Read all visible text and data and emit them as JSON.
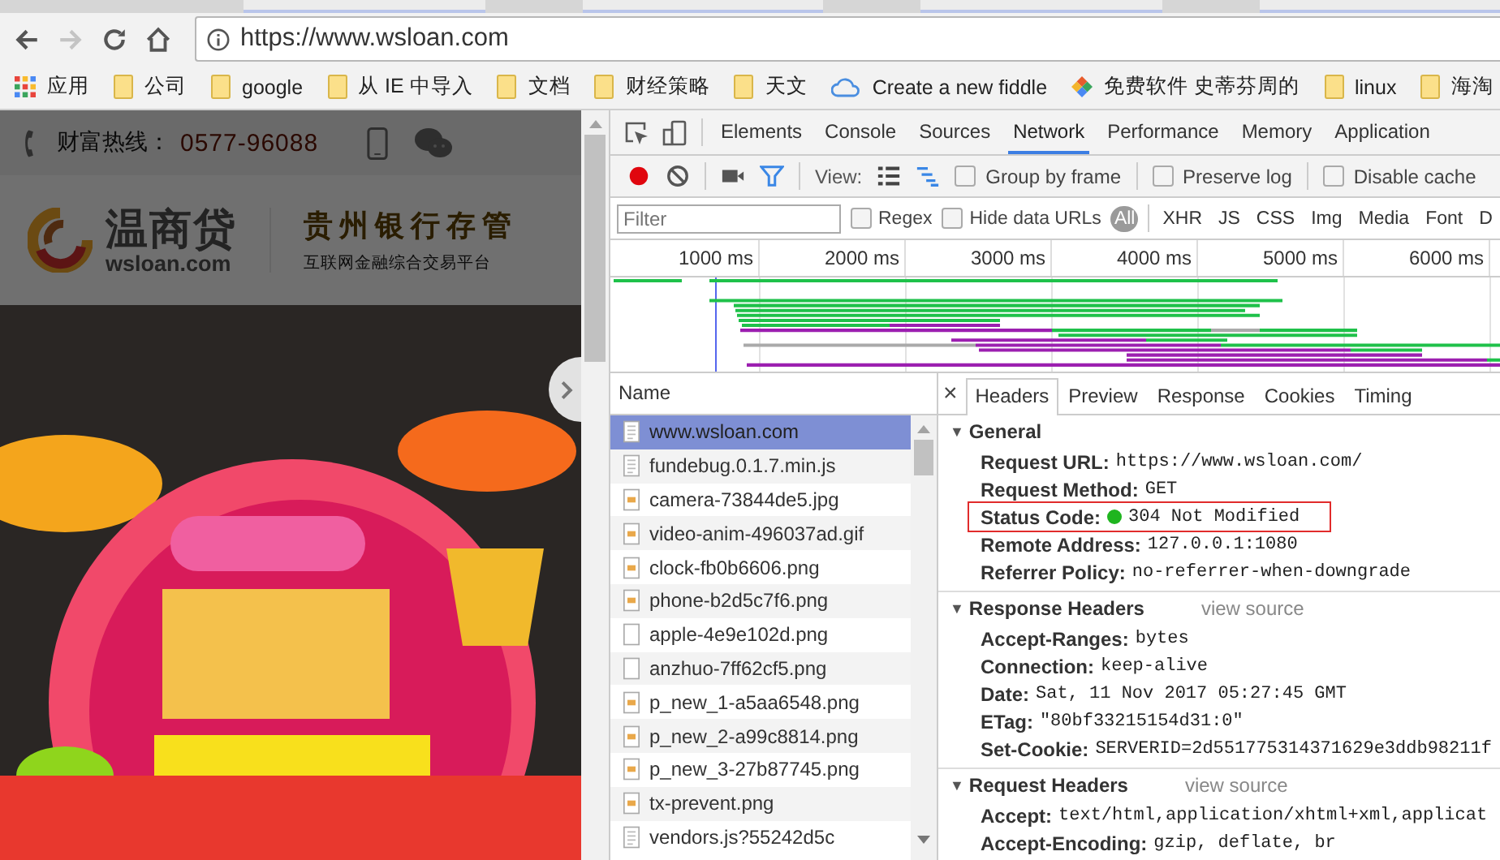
{
  "browser": {
    "url": "https://www.wsloan.com",
    "forward_disabled": true,
    "bookmarks": [
      {
        "label": "应用",
        "kind": "apps"
      },
      {
        "label": "公司",
        "kind": "folder"
      },
      {
        "label": "google",
        "kind": "folder"
      },
      {
        "label": "从 IE 中导入",
        "kind": "folder"
      },
      {
        "label": "文档",
        "kind": "folder"
      },
      {
        "label": "财经策略",
        "kind": "folder"
      },
      {
        "label": "天文",
        "kind": "folder"
      },
      {
        "label": "Create a new fiddle",
        "kind": "cloud"
      },
      {
        "label": "免费软件 史蒂芬周的",
        "kind": "site"
      },
      {
        "label": "linux",
        "kind": "folder"
      },
      {
        "label": "海淘",
        "kind": "folder"
      }
    ]
  },
  "page": {
    "hotline_label": "财富热线：",
    "hotline_number": "0577-96088",
    "logo_name": "温商贷",
    "logo_domain": "wsloan.com",
    "bank_text": "贵州银行存管",
    "slogan": "互联网金融综合交易平台"
  },
  "devtools": {
    "tabs": [
      {
        "label": "Elements",
        "selected": false
      },
      {
        "label": "Console",
        "selected": false
      },
      {
        "label": "Sources",
        "selected": false
      },
      {
        "label": "Network",
        "selected": true
      },
      {
        "label": "Performance",
        "selected": false
      },
      {
        "label": "Memory",
        "selected": false
      },
      {
        "label": "Application",
        "selected": false
      }
    ],
    "recording": true,
    "view_label": "View:",
    "toolbar_options": [
      {
        "label": "Group by frame",
        "checked": false
      },
      {
        "label": "Preserve log",
        "checked": false
      },
      {
        "label": "Disable cache",
        "checked": false
      }
    ],
    "filter": {
      "placeholder": "Filter"
    },
    "filter_options": [
      {
        "label": "Regex",
        "checked": false
      },
      {
        "label": "Hide data URLs",
        "checked": false
      }
    ],
    "types": [
      {
        "label": "All",
        "selected": true
      },
      {
        "label": "XHR",
        "selected": false
      },
      {
        "label": "JS",
        "selected": false
      },
      {
        "label": "CSS",
        "selected": false
      },
      {
        "label": "Img",
        "selected": false
      },
      {
        "label": "Media",
        "selected": false
      },
      {
        "label": "Font",
        "selected": false
      },
      {
        "label": "D",
        "selected": false
      }
    ],
    "ruler": [
      "1000 ms",
      "2000 ms",
      "3000 ms",
      "4000 ms",
      "5000 ms",
      "6000 ms"
    ],
    "requests": {
      "column": "Name",
      "rows": [
        {
          "name": "www.wsloan.com",
          "kind": "document",
          "selected": true
        },
        {
          "name": "fundebug.0.1.7.min.js",
          "kind": "document",
          "selected": false
        },
        {
          "name": "camera-73844de5.jpg",
          "kind": "image",
          "selected": false
        },
        {
          "name": "video-anim-496037ad.gif",
          "kind": "image",
          "selected": false
        },
        {
          "name": "clock-fb0b6606.png",
          "kind": "image",
          "selected": false
        },
        {
          "name": "phone-b2d5c7f6.png",
          "kind": "image",
          "selected": false
        },
        {
          "name": "apple-4e9e102d.png",
          "kind": "blank",
          "selected": false
        },
        {
          "name": "anzhuo-7ff62cf5.png",
          "kind": "blank",
          "selected": false
        },
        {
          "name": "p_new_1-a5aa6548.png",
          "kind": "image",
          "selected": false
        },
        {
          "name": "p_new_2-a99c8814.png",
          "kind": "image",
          "selected": false
        },
        {
          "name": "p_new_3-27b87745.png",
          "kind": "image",
          "selected": false
        },
        {
          "name": "tx-prevent.png",
          "kind": "image",
          "selected": false
        },
        {
          "name": "vendors.js?55242d5c",
          "kind": "document",
          "selected": false
        }
      ]
    },
    "close_icon": "×",
    "detail_tabs": [
      {
        "label": "Headers",
        "selected": true
      },
      {
        "label": "Preview",
        "selected": false
      },
      {
        "label": "Response",
        "selected": false
      },
      {
        "label": "Cookies",
        "selected": false
      },
      {
        "label": "Timing",
        "selected": false
      }
    ],
    "sections": [
      {
        "title": "General",
        "arrow": "▼",
        "expanded": true,
        "rows": [
          {
            "key": "Request URL:",
            "value": "https://www.wsloan.com/"
          },
          {
            "key": "Request Method:",
            "value": "GET"
          },
          {
            "key": "Status Code:",
            "value": "304 Not Modified",
            "color": "#1fb51f",
            "highlighted": true
          },
          {
            "key": "Remote Address:",
            "value": "127.0.0.1:1080"
          },
          {
            "key": "Referrer Policy:",
            "value": "no-referrer-when-downgrade"
          }
        ]
      },
      {
        "title": "Response Headers",
        "arrow": "▼",
        "expanded": true,
        "link": "view source",
        "rows": [
          {
            "key": "Accept-Ranges:",
            "value": "bytes"
          },
          {
            "key": "Connection:",
            "value": "keep-alive"
          },
          {
            "key": "Date:",
            "value": "Sat, 11 Nov 2017 05:27:45 GMT"
          },
          {
            "key": "ETag:",
            "value": "\"80bf33215154d31:0\""
          },
          {
            "key": "Set-Cookie:",
            "value": "SERVERID=2d551775314371629e3ddb98211f"
          }
        ]
      },
      {
        "title": "Request Headers",
        "arrow": "▼",
        "expanded": true,
        "link": "view source",
        "rows": [
          {
            "key": "Accept:",
            "value": "text/html,application/xhtml+xml,applicat"
          },
          {
            "key": "Accept-Encoding:",
            "value": "gzip, deflate, br"
          }
        ]
      }
    ]
  }
}
